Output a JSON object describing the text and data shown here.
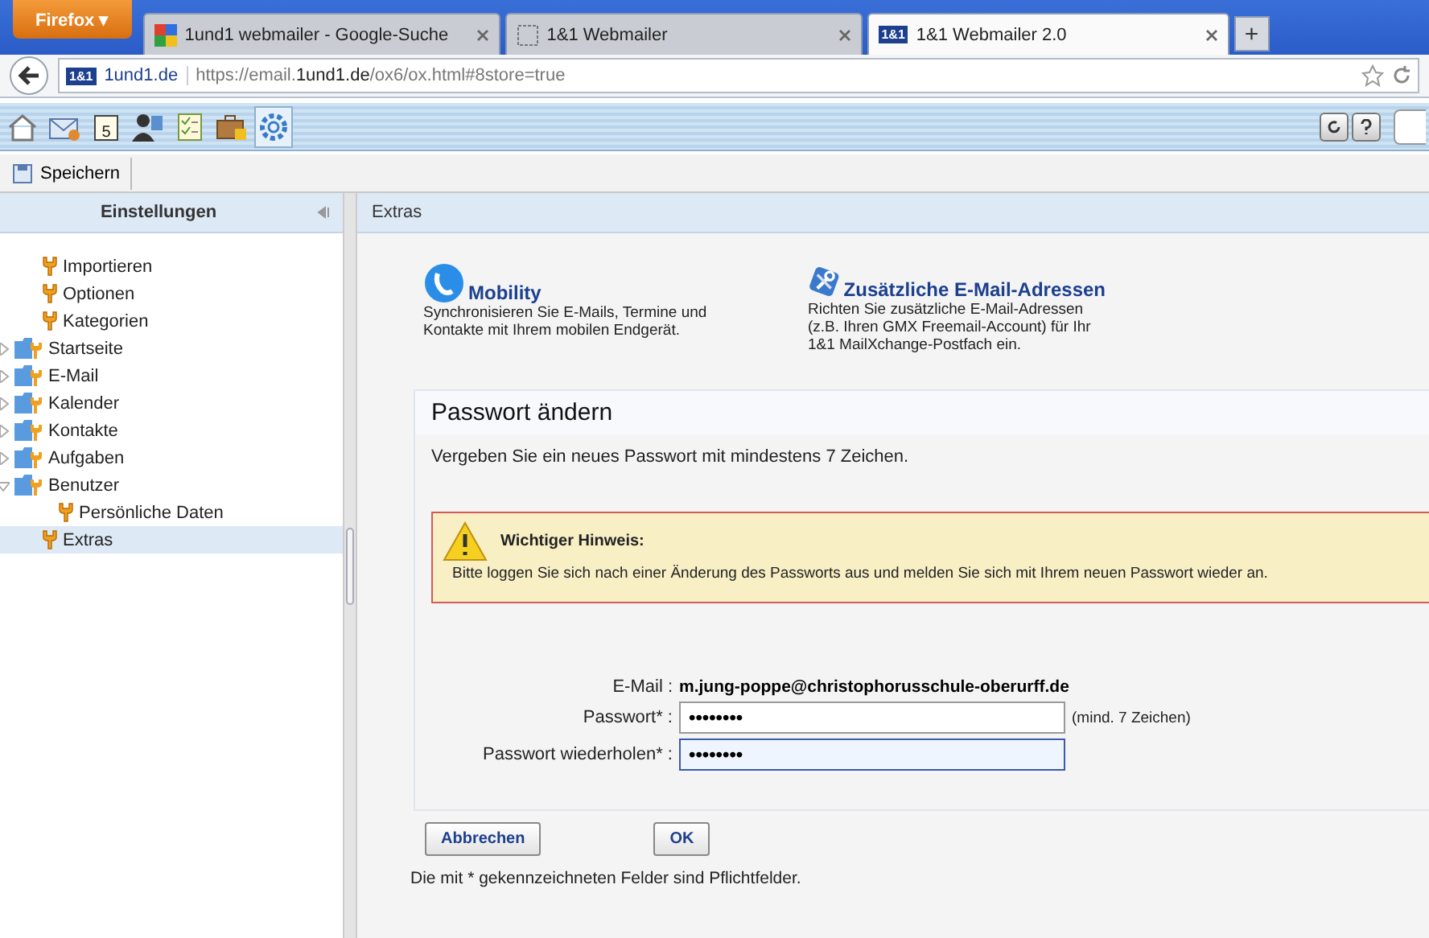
{
  "browser": {
    "menu_button": "Firefox ▾",
    "tabs": [
      {
        "label": "1und1 webmailer - Google-Suche",
        "selected": false
      },
      {
        "label": "1&1 Webmailer",
        "selected": false
      },
      {
        "label": "1&1 Webmailer 2.0",
        "badge": "1&1",
        "selected": true
      }
    ],
    "new_tab": "+",
    "site_badge": "1&1",
    "site": "1und1.de",
    "url": {
      "before": "https://email.",
      "domain": "1und1.de",
      "after": "/ox6/ox.html#8store=true"
    }
  },
  "app_toolbar": {
    "tools": [
      {
        "kind": "home",
        "selected": false
      },
      {
        "kind": "mail",
        "selected": false
      },
      {
        "kind": "calendar",
        "selected": false
      },
      {
        "kind": "contacts",
        "selected": false
      },
      {
        "kind": "tasks",
        "selected": false
      },
      {
        "kind": "infostore",
        "selected": false
      },
      {
        "kind": "settings",
        "selected": true
      }
    ],
    "calendar_day": "5"
  },
  "action_bar": {
    "save": "Speichern"
  },
  "sidebar": {
    "title": "Einstellungen",
    "items": [
      {
        "label": "Importieren",
        "kind": "setting",
        "selected": false
      },
      {
        "label": "Optionen",
        "kind": "setting",
        "selected": false
      },
      {
        "label": "Kategorien",
        "kind": "setting",
        "selected": false
      },
      {
        "label": "Startseite",
        "kind": "group",
        "expanded": false,
        "selected": false
      },
      {
        "label": "E-Mail",
        "kind": "group",
        "expanded": false,
        "selected": false
      },
      {
        "label": "Kalender",
        "kind": "group",
        "expanded": false,
        "selected": false
      },
      {
        "label": "Kontakte",
        "kind": "group",
        "expanded": false,
        "selected": false
      },
      {
        "label": "Aufgaben",
        "kind": "group",
        "expanded": false,
        "selected": false
      },
      {
        "label": "Benutzer",
        "kind": "group",
        "expanded": true,
        "selected": false,
        "children": [
          {
            "label": "Persönliche Daten",
            "kind": "setting",
            "selected": false
          }
        ]
      },
      {
        "label": "Extras",
        "kind": "setting",
        "selected": true
      }
    ]
  },
  "content": {
    "title": "Extras",
    "extras": [
      {
        "kind": "phone",
        "title": "Mobility",
        "text": "Synchronisieren Sie E-Mails, Termine und Kontakte mit Ihrem mobilen Endgerät."
      },
      {
        "kind": "tools",
        "title": "Zusätzliche E-Mail-Adressen",
        "text": "Richten Sie zusätzliche E-Mail-Adressen (z.B. Ihren GMX Freemail-Account) für Ihr 1&1 MailXchange-Postfach ein."
      }
    ],
    "panel": {
      "title": "Passwort ändern",
      "intro": "Vergeben Sie ein neues Passwort mit mindestens 7 Zeichen.",
      "notice": {
        "title": "Wichtiger Hinweis:",
        "text": "Bitte loggen Sie sich nach einer Änderung des Passworts aus und melden Sie sich mit Ihrem neuen Passwort wieder an."
      },
      "email_label": "E-Mail :",
      "email": "m.jung-poppe@christophorusschule-oberurff.de",
      "fields": [
        {
          "label": "Passwort* :",
          "value": "••••••••",
          "hint": "(mind. 7 Zeichen)",
          "focused": false
        },
        {
          "label": "Passwort wiederholen* :",
          "value": "••••••••",
          "focused": true
        }
      ]
    },
    "buttons": [
      "Abbrechen",
      "OK"
    ],
    "footnote": "Die mit * gekennzeichneten Felder sind Pflichtfelder."
  }
}
